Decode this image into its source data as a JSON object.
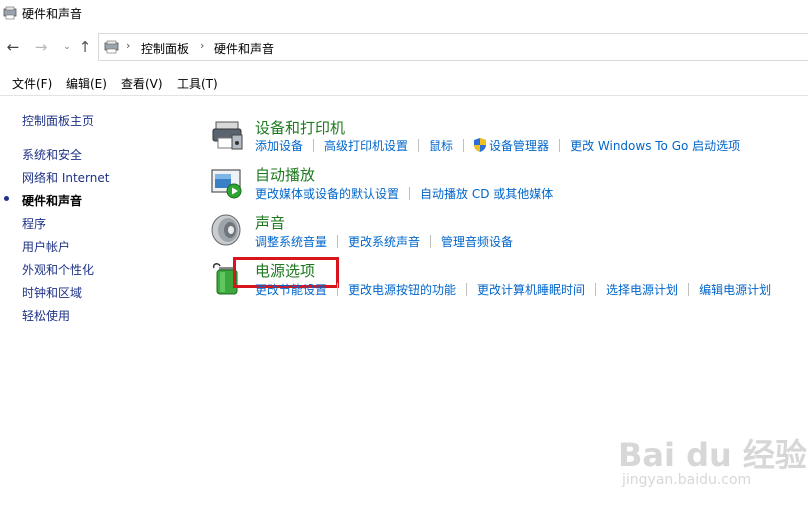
{
  "window": {
    "title": "硬件和声音",
    "app_icon": "control-panel-icon"
  },
  "navigation": {
    "back_icon": "←",
    "forward_icon": "→",
    "recent_icon": "⌄",
    "up_icon": "↑",
    "breadcrumb": [
      "控制面板",
      "硬件和声音"
    ],
    "separator": "›"
  },
  "menu": {
    "items": [
      "文件(F)",
      "编辑(E)",
      "查看(V)",
      "工具(T)"
    ]
  },
  "sidebar": {
    "items": [
      "控制面板主页",
      "系统和安全",
      "网络和 Internet",
      "硬件和声音",
      "程序",
      "用户帐户",
      "外观和个性化",
      "时钟和区域",
      "轻松使用"
    ],
    "current": "硬件和声音"
  },
  "categories": [
    {
      "title": "设备和打印机",
      "icon": "printer-icon",
      "links": [
        "添加设备",
        "高级打印机设置",
        "鼠标",
        "设备管理器",
        "更改 Windows To Go 启动选项"
      ]
    },
    {
      "title": "自动播放",
      "icon": "autoplay-icon",
      "links": [
        "更改媒体或设备的默认设置",
        "自动播放 CD 或其他媒体"
      ]
    },
    {
      "title": "声音",
      "icon": "speaker-icon",
      "links": [
        "调整系统音量",
        "更改系统声音",
        "管理音频设备"
      ]
    },
    {
      "title": "电源选项",
      "icon": "battery-icon",
      "links": [
        "更改节能设置",
        "更改电源按钮的功能",
        "更改计算机睡眠时间",
        "选择电源计划",
        "编辑电源计划"
      ]
    }
  ],
  "watermark": {
    "brand": "Bai du 经验",
    "url": "jingyan.baidu.com"
  },
  "colors": {
    "link": "#0066cc",
    "category_title": "#1e7a1e",
    "sidebar_link": "#1e3287",
    "highlight": "#d8141c"
  }
}
